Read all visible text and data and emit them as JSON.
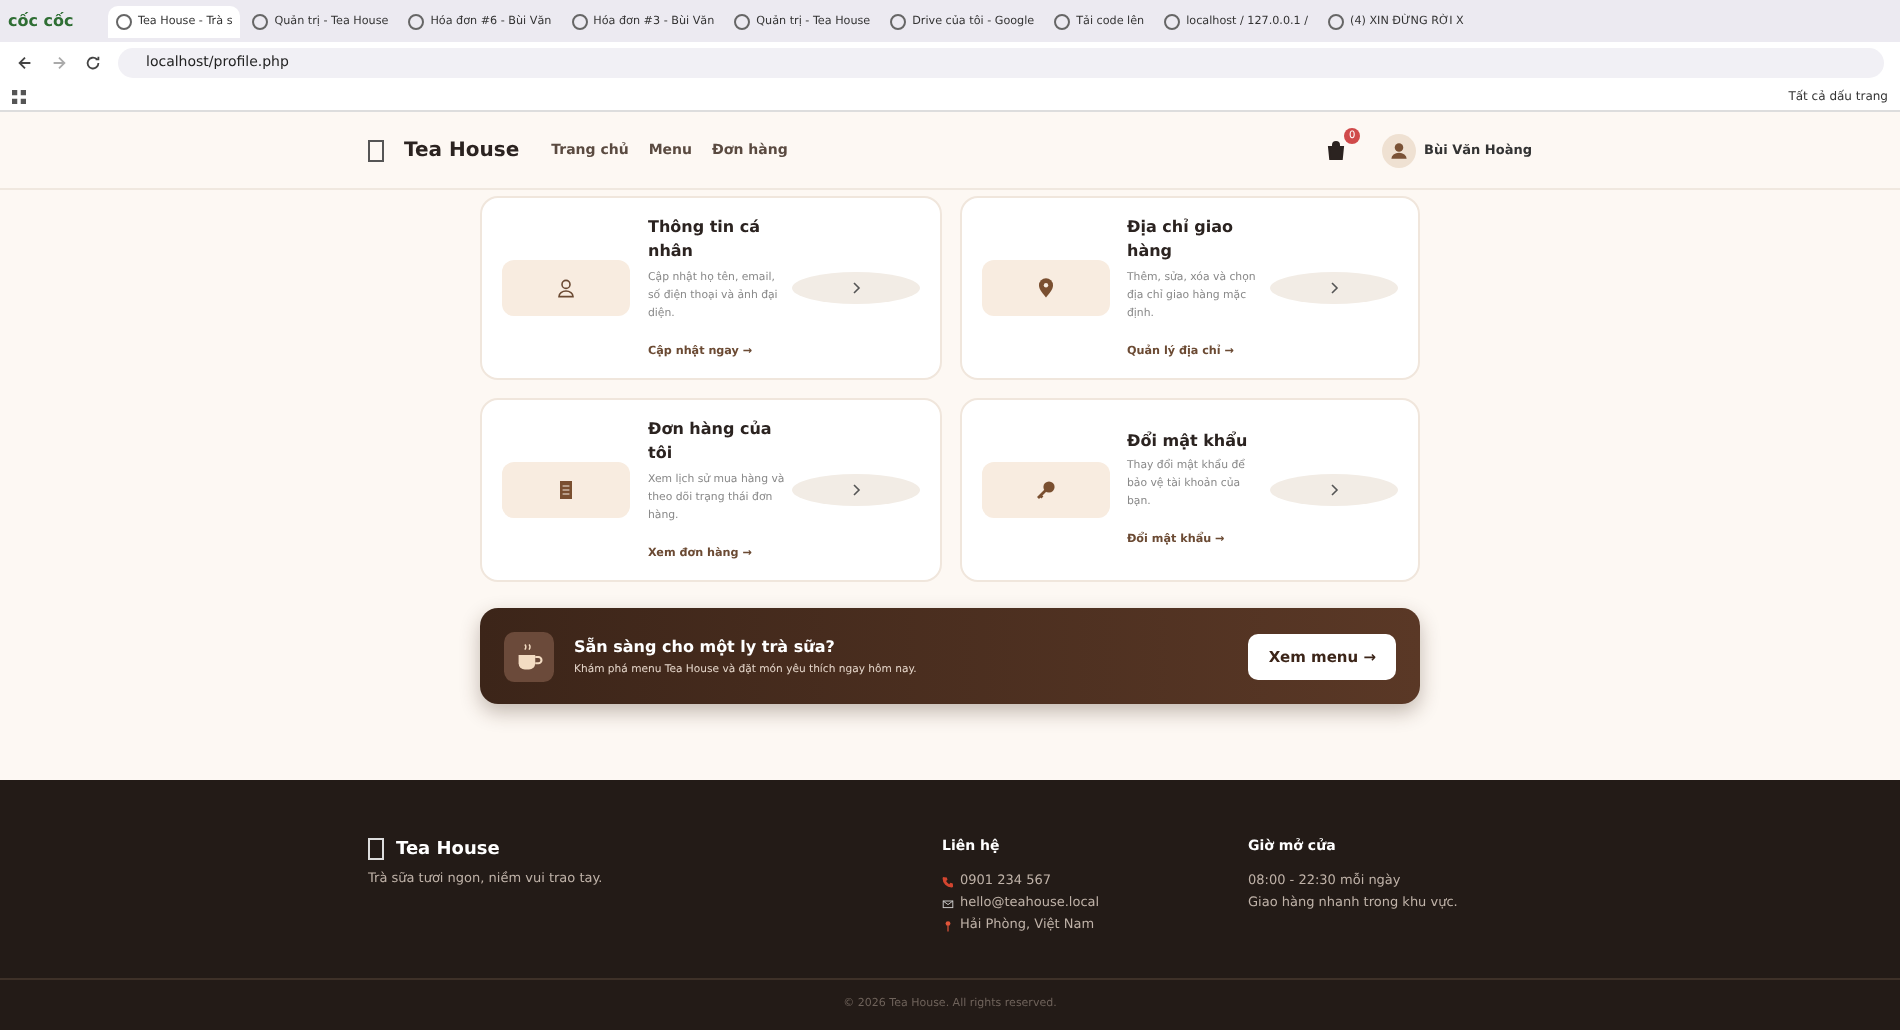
{
  "browser": {
    "logo_text": "cốc cốc",
    "tabs": [
      {
        "title": "Tea House - Trà s",
        "selected": true
      },
      {
        "title": "Quản trị - Tea House",
        "selected": false
      },
      {
        "title": "Hóa đơn #6 - Bùi Văn",
        "selected": false
      },
      {
        "title": "Hóa đơn #3 - Bùi Văn",
        "selected": false
      },
      {
        "title": "Quản trị - Tea House",
        "selected": false
      },
      {
        "title": "Drive của tôi - Google",
        "selected": false
      },
      {
        "title": "Tải code lên",
        "selected": false
      },
      {
        "title": "localhost / 127.0.0.1 /",
        "selected": false
      },
      {
        "title": "(4) XIN ĐỪNG RỜI X",
        "selected": false
      }
    ],
    "address": "localhost/profile.php",
    "bookmarks_label": "Tất cả dấu trang"
  },
  "nav": {
    "brand": "Tea House",
    "links": [
      "Trang chủ",
      "Menu",
      "Đơn hàng"
    ],
    "cart_count": "0",
    "user_name": "Bùi Văn Hoàng"
  },
  "cards": [
    {
      "kind": "user",
      "title": "Thông tin cá nhân",
      "description": "Cập nhật họ tên, email, số điện thoại và ảnh đại diện.",
      "link": "Cập nhật ngay →"
    },
    {
      "kind": "pin",
      "title": "Địa chỉ giao hàng",
      "description": "Thêm, sửa, xóa và chọn địa chỉ giao hàng mặc định.",
      "link": "Quản lý địa chỉ →"
    },
    {
      "kind": "receipt",
      "title": "Đơn hàng của tôi",
      "description": "Xem lịch sử mua hàng và theo dõi trạng thái đơn hàng.",
      "link": "Xem đơn hàng →"
    },
    {
      "kind": "key",
      "title": "Đổi mật khẩu",
      "description": "Thay đổi mật khẩu để bảo vệ tài khoản của bạn.",
      "link": "Đổi mật khẩu →"
    }
  ],
  "banner": {
    "title": "Sẵn sàng cho một ly trà sữa?",
    "subtitle": "Khám phá menu Tea House và đặt món yêu thích ngay hôm nay.",
    "button": "Xem menu →"
  },
  "footer": {
    "brand": "Tea House",
    "tagline": "Trà sữa tươi ngon, niềm vui trao tay.",
    "contact": {
      "heading": "Liên hệ",
      "items": [
        {
          "kind": "phone",
          "text": "0901 234 567"
        },
        {
          "kind": "mail",
          "text": "hello@teahouse.local"
        },
        {
          "kind": "pin",
          "text": "Hải Phòng, Việt Nam"
        }
      ]
    },
    "hours": {
      "heading": "Giờ mở cửa",
      "lines": [
        "08:00 - 22:30 mỗi ngày",
        "Giao hàng nhanh trong khu vực."
      ]
    },
    "copyright": "© 2026 Tea House. All rights reserved."
  }
}
